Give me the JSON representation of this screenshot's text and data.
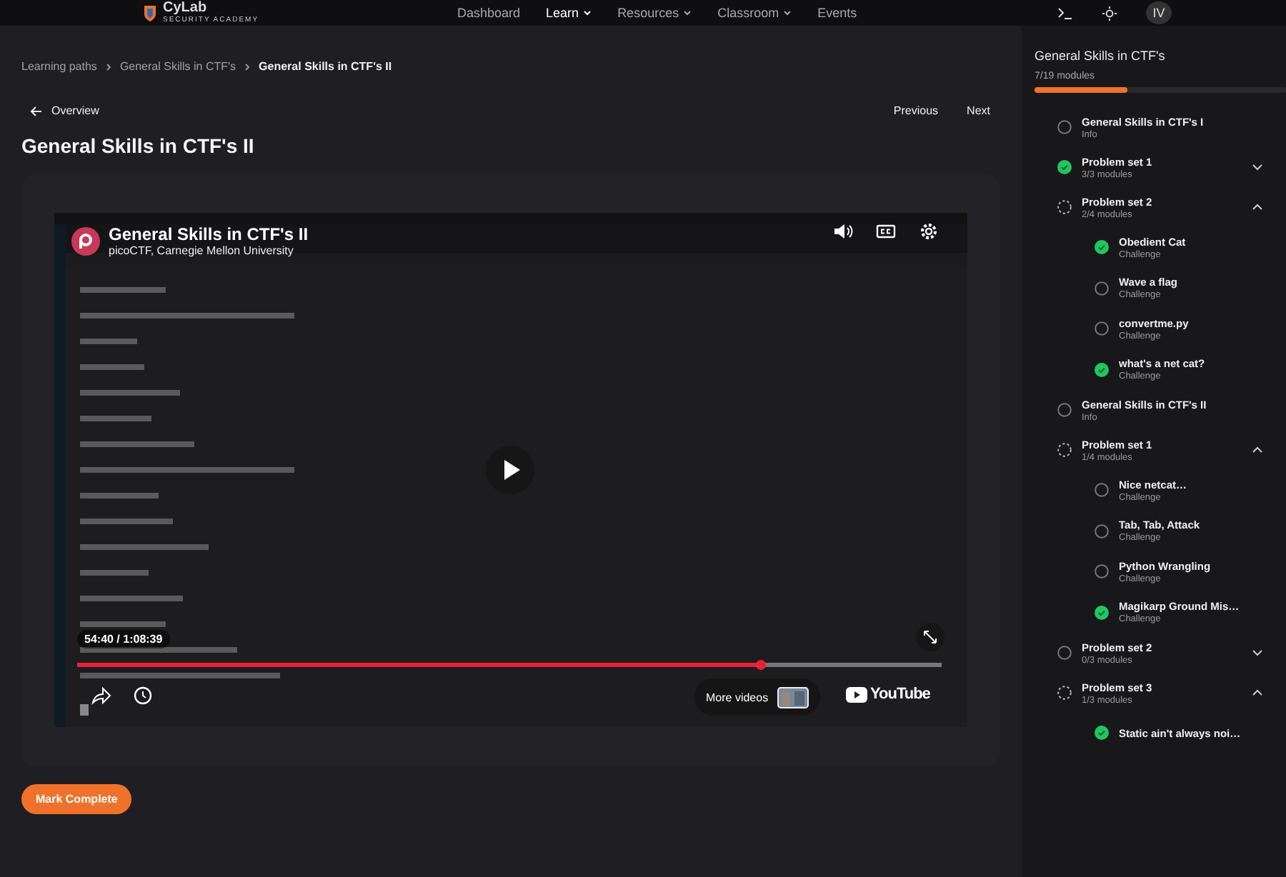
{
  "header": {
    "logo": {
      "name": "CyLab",
      "tagline": "SECURITY ACADEMY"
    },
    "nav": [
      {
        "label": "Dashboard",
        "selected": false,
        "dropdown": false
      },
      {
        "label": "Learn",
        "selected": true,
        "dropdown": true
      },
      {
        "label": "Resources",
        "selected": false,
        "dropdown": true
      },
      {
        "label": "Classroom",
        "selected": false,
        "dropdown": true
      },
      {
        "label": "Events",
        "selected": false,
        "dropdown": false
      }
    ],
    "avatar": "IV"
  },
  "breadcrumbs": [
    "Learning paths",
    "General Skills in CTF's",
    "General Skills in CTF's II"
  ],
  "back_link": "Overview",
  "pager": [
    "Previous",
    "Next"
  ],
  "title": "General Skills in CTF's II",
  "video": {
    "title": "General Skills in CTF's II",
    "channel": "picoCTF, Carnegie Mellon University",
    "time": "54:40 / 1:08:39",
    "level": 0.79,
    "more_videos": "More videos",
    "brand": "YouTube"
  },
  "mark_complete": "Mark Complete",
  "sidebar": {
    "title": "General Skills in CTF's",
    "progress_text": "7/19 modules",
    "level": 0.37,
    "items": [
      {
        "title": "General Skills in CTF's I",
        "subtitle": "Info",
        "kind": "todo"
      },
      {
        "title": "Problem set 1",
        "subtitle": "3/3 modules",
        "kind": "done",
        "expanded": false
      },
      {
        "title": "Problem set 2",
        "subtitle": "2/4 modules",
        "kind": "progress",
        "expanded": true,
        "children": [
          {
            "title": "Obedient Cat",
            "subtitle": "Challenge",
            "kind": "done"
          },
          {
            "title": "Wave a flag",
            "subtitle": "Challenge",
            "kind": "todo"
          },
          {
            "title": "convertme.py",
            "subtitle": "Challenge",
            "kind": "todo"
          },
          {
            "title": "what's a net cat?",
            "subtitle": "Challenge",
            "kind": "done"
          }
        ]
      },
      {
        "title": "General Skills in CTF's II",
        "subtitle": "Info",
        "kind": "todo"
      },
      {
        "title": "Problem set 1",
        "subtitle": "1/4 modules",
        "kind": "progress",
        "expanded": true,
        "children": [
          {
            "title": "Nice netcat…",
            "subtitle": "Challenge",
            "kind": "todo"
          },
          {
            "title": "Tab, Tab, Attack",
            "subtitle": "Challenge",
            "kind": "todo"
          },
          {
            "title": "Python Wrangling",
            "subtitle": "Challenge",
            "kind": "todo"
          },
          {
            "title": "Magikarp Ground Mis…",
            "subtitle": "Challenge",
            "kind": "done"
          }
        ]
      },
      {
        "title": "Problem set 2",
        "subtitle": "0/3 modules",
        "kind": "todo",
        "expanded": false
      },
      {
        "title": "Problem set 3",
        "subtitle": "1/3 modules",
        "kind": "progress",
        "expanded": true,
        "children": [
          {
            "title": "Static ain't always noi…",
            "kind": "done"
          }
        ]
      }
    ]
  }
}
